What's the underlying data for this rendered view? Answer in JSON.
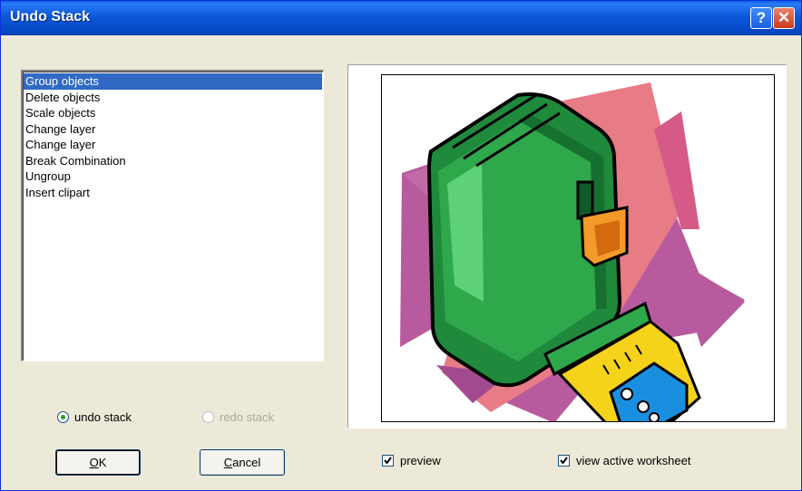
{
  "window": {
    "title": "Undo Stack",
    "help_glyph": "?",
    "close_glyph": "✕"
  },
  "undo_list": {
    "items": [
      "Group objects",
      "Delete objects",
      "Scale objects",
      "Change layer",
      "Change layer",
      "Break Combination",
      "Ungroup",
      "Insert clipart"
    ],
    "selected_index": 0
  },
  "stack_mode": {
    "undo_label": "undo stack",
    "redo_label": "redo stack",
    "selected": "undo stack",
    "redo_enabled": false
  },
  "buttons": {
    "ok_label": "OK",
    "ok_mnemonic": "O",
    "cancel_label": "Cancel",
    "cancel_mnemonic": "C"
  },
  "options": {
    "preview_label": "preview",
    "preview_checked": true,
    "view_active_label": "view active worksheet",
    "view_active_checked": true
  },
  "preview": {
    "image": "tape-measure-clipart"
  },
  "colors": {
    "title_bar": "#0a58d8",
    "selection": "#316ac5",
    "dialog_bg": "#ece9d8"
  }
}
